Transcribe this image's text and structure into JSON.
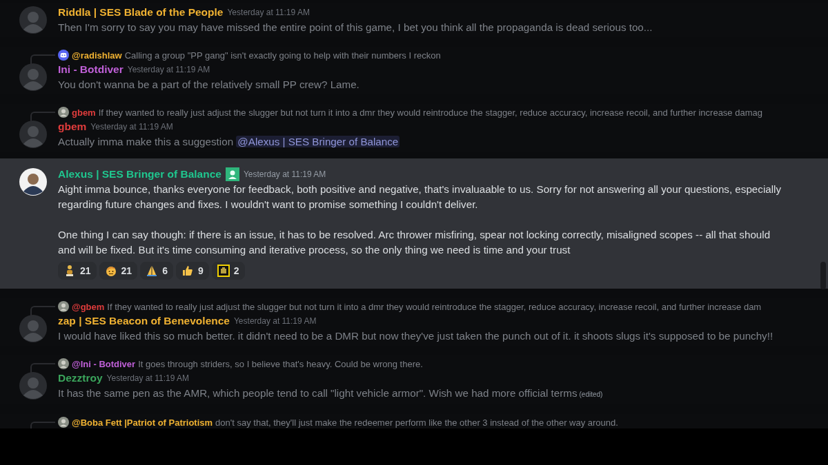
{
  "channel": {
    "messages": [
      {
        "highlighted": false,
        "author": {
          "name": "Riddla | SES Blade of the People",
          "color": "#f0b232"
        },
        "timestamp": "Yesterday at 11:19 AM",
        "paragraphs": [
          "Then I'm sorry to say you may have missed the entire point of this game, I bet you think all the propaganda is dead serious too..."
        ]
      },
      {
        "highlighted": false,
        "reply": {
          "kind": "discord",
          "author": "@radishlaw",
          "color": "#f0b232",
          "text": "Calling a group \"PP gang\" isn't exactly going to help with their numbers I reckon"
        },
        "author": {
          "name": "Ini - Botdiver",
          "color": "#c060d8"
        },
        "timestamp": "Yesterday at 11:19 AM",
        "paragraphs": [
          "You don't wanna be a part of the relatively small PP crew? Lame."
        ]
      },
      {
        "highlighted": false,
        "reply": {
          "kind": "avatar",
          "author": "gbem",
          "color": "#e03c3c",
          "text": "If they wanted to really just adjust the slugger but not turn it into a dmr they would reintroduce the stagger, reduce accuracy, increase recoil, and further increase damag"
        },
        "author": {
          "name": "gbem",
          "color": "#e03c3c"
        },
        "timestamp": "Yesterday at 11:19 AM",
        "paragraphs": [
          "Actually imma make this a suggestion"
        ],
        "mention": "@Alexus | SES Bringer of Balance"
      },
      {
        "highlighted": true,
        "author": {
          "name": "Alexus | SES Bringer of Balance",
          "color": "#1fc78f"
        },
        "role_icon": true,
        "timestamp": "Yesterday at 11:19 AM",
        "paragraphs": [
          "Aight imma bounce, thanks everyone for feedback, both positive and negative, that's invaluaable to us. Sorry for not answering all your questions, especially regarding future changes and fixes. I wouldn't want to promise something I couldn't deliver.",
          "One thing I can say though: if there is an issue, it has to be resolved. Arc thrower misfiring, spear not locking correctly, misaligned scopes -- all that should and will be fixed. But it's time consuming and iterative process, so the only thing we need is time and your trust"
        ],
        "reactions": [
          {
            "kind": "figure",
            "count": "21"
          },
          {
            "kind": "face",
            "count": "21"
          },
          {
            "kind": "pray",
            "count": "6"
          },
          {
            "kind": "thumbs",
            "count": "9"
          },
          {
            "kind": "box",
            "count": "2"
          }
        ]
      },
      {
        "highlighted": false,
        "reply": {
          "kind": "avatar",
          "author": "@gbem",
          "color": "#e03c3c",
          "text": "If they wanted to really just adjust the slugger but not turn it into a dmr they would reintroduce the stagger, reduce accuracy, increase recoil, and further increase dam"
        },
        "author": {
          "name": "zap | SES Beacon of Benevolence",
          "color": "#f0b232"
        },
        "timestamp": "Yesterday at 11:19 AM",
        "paragraphs": [
          "I would have liked this so much better. it didn't need to be a DMR but now they've just taken the punch out of it. it shoots slugs it's supposed to be punchy!!"
        ]
      },
      {
        "highlighted": false,
        "reply": {
          "kind": "avatar",
          "author": "@Ini - Botdiver",
          "color": "#c060d8",
          "text": "It goes through striders, so I believe that's heavy. Could be wrong there."
        },
        "author": {
          "name": "Dezztroy",
          "color": "#3ba55c"
        },
        "timestamp": "Yesterday at 11:19 AM",
        "paragraphs": [
          "It has the same pen as the AMR, which people tend to call \"light vehicle armor\". Wish we had more official terms"
        ],
        "edited": "(edited)"
      },
      {
        "highlighted": false,
        "reply": {
          "kind": "avatar",
          "author": "@Boba Fett |Patriot of Patriotism",
          "color": "#f0b232",
          "text": "don't say that, they'll just make the redeemer perform like the other 3 instead of the other way around."
        }
      }
    ]
  }
}
